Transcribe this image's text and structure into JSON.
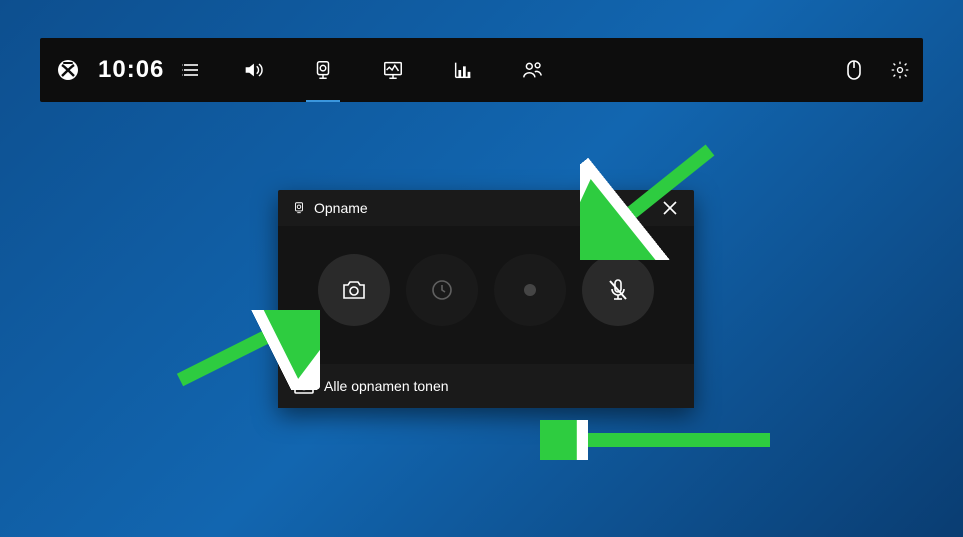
{
  "topbar": {
    "time": "10:06"
  },
  "widget": {
    "title": "Opname",
    "footer_label": "Alle opnamen tonen"
  }
}
